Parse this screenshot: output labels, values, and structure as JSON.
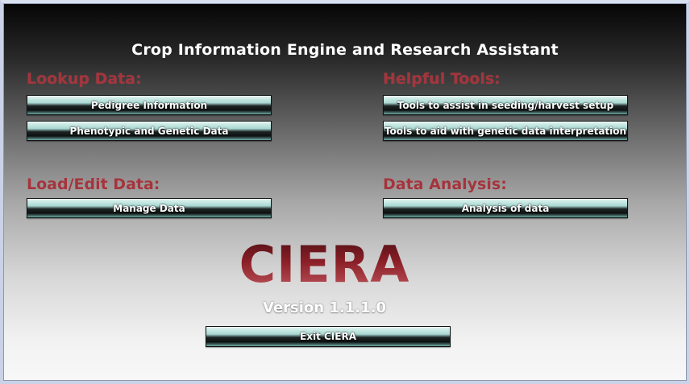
{
  "app": {
    "title": "Crop Information Engine and Research Assistant",
    "logo_text": "CIERA",
    "version": "Version 1.1.1.0"
  },
  "colors": {
    "heading": "#a5343c",
    "logo": "#8a1f27",
    "button_text": "#ffffff"
  },
  "sections": {
    "lookup": {
      "heading": "Lookup Data:",
      "buttons": [
        "Pedigree Information",
        "Phenotypic and Genetic Data"
      ]
    },
    "tools": {
      "heading": "Helpful Tools:",
      "buttons": [
        "Tools to assist in seeding/harvest setup",
        "Tools to aid with genetic data interpretation"
      ]
    },
    "load": {
      "heading": "Load/Edit Data:",
      "buttons": [
        "Manage Data"
      ]
    },
    "analysis": {
      "heading": "Data Analysis:",
      "buttons": [
        "Analysis of data"
      ]
    }
  },
  "exit_button": "Exit CIERA"
}
